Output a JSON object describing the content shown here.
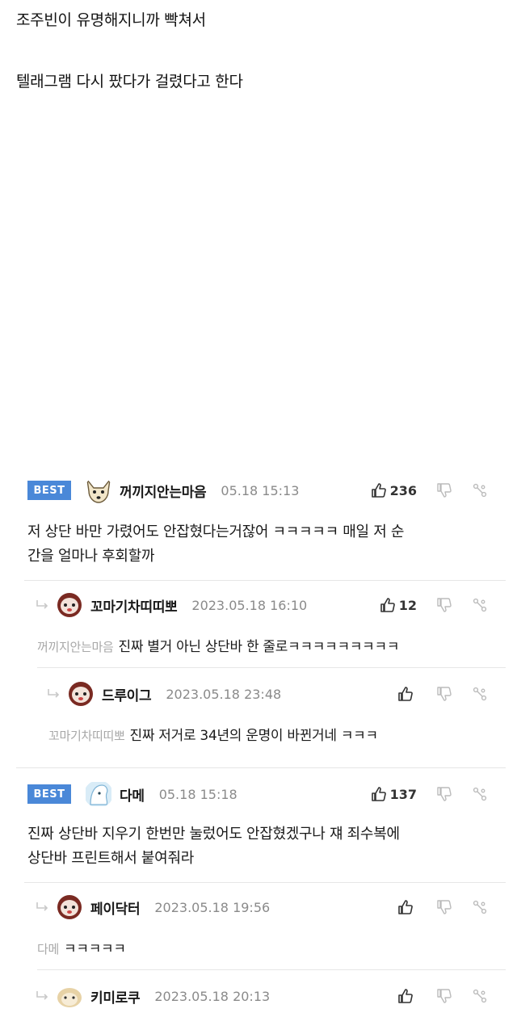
{
  "post": {
    "line1": "조주빈이 유명해지니까 빡쳐서",
    "line2": "텔래그램 다시 팠다가 걸렸다고 한다"
  },
  "comments": [
    {
      "best_label": "BEST",
      "nick": "꺼끼지안는마음",
      "time": "05.18 15:13",
      "likes": "236",
      "text1": "저 상단 바만 가렸어도 안잡혔다는거잖어 ㅋㅋㅋㅋㅋ 매일 저 순",
      "text2": "간을 얼마나 후회할까"
    },
    {
      "nick": "꼬마기차띠띠뽀",
      "time": "2023.05.18 16:10",
      "likes": "12",
      "mention": "꺼끼지안는마음",
      "text": "진짜 별거 아닌 상단바 한 줄로ㅋㅋㅋㅋㅋㅋㅋㅋㅋ"
    },
    {
      "nick": "드루이그",
      "time": "2023.05.18 23:48",
      "mention": "꼬마기차띠띠뽀",
      "text": "진짜 저거로 34년의 운명이 바뀐거네 ㅋㅋㅋ"
    },
    {
      "best_label": "BEST",
      "nick": "다메",
      "time": "05.18 15:18",
      "likes": "137",
      "text1": "진짜 상단바 지우기 한번만 눌렀어도 안잡혔겠구나 쟤 죄수복에",
      "text2": "상단바 프린트해서 붙여줘라"
    },
    {
      "nick": "페이닥터",
      "time": "2023.05.18 19:56",
      "mention": "다메",
      "text": "ㅋㅋㅋㅋㅋ"
    },
    {
      "nick": "키미로쿠",
      "time": "2023.05.18 20:13"
    }
  ],
  "icons": {
    "like": "thumbs-up-icon",
    "dislike": "thumbs-down-icon",
    "share": "share-icon",
    "reply": "reply-arrow-icon"
  },
  "colors": {
    "best_badge": "#4a88d8",
    "muted": "#8a8a8a"
  }
}
